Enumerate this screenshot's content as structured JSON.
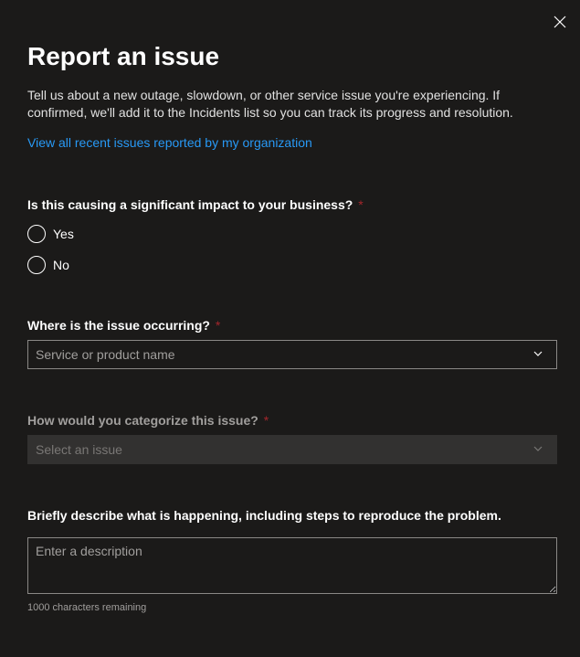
{
  "header": {
    "title": "Report an issue",
    "intro": "Tell us about a new outage, slowdown, or other service issue you're experiencing. If confirmed, we'll add it to the Incidents list so you can track its progress and resolution.",
    "link_text": "View all recent issues reported by my organization"
  },
  "form": {
    "impact": {
      "label": "Is this causing a significant impact to your business?",
      "required_mark": "*",
      "options": {
        "yes": "Yes",
        "no": "No"
      }
    },
    "location": {
      "label": "Where is the issue occurring?",
      "required_mark": "*",
      "placeholder": "Service or product name"
    },
    "category": {
      "label": "How would you categorize this issue?",
      "required_mark": "*",
      "placeholder": "Select an issue"
    },
    "description": {
      "label": "Briefly describe what is happening, including steps to reproduce the problem.",
      "placeholder": "Enter a description",
      "char_count_text": "1000 characters remaining"
    }
  }
}
